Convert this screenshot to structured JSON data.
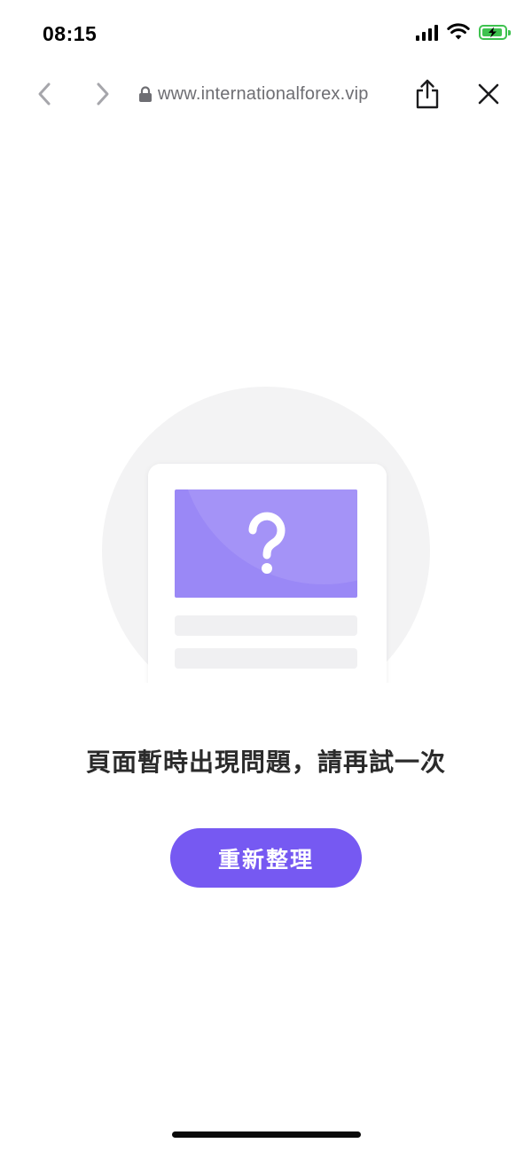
{
  "status_bar": {
    "time": "08:15",
    "icons": [
      "signal-icon",
      "wifi-icon",
      "battery-charging-icon"
    ],
    "battery_color": "#3ec24f"
  },
  "toolbar": {
    "back_icon": "chevron-left-icon",
    "forward_icon": "chevron-right-icon",
    "lock_icon": "lock-icon",
    "url": "www.internationalforex.vip",
    "share_icon": "share-icon",
    "close_icon": "close-icon"
  },
  "error_page": {
    "illustration_icon": "question-mark-icon",
    "message": "頁面暫時出現問題，請再試一次",
    "reload_label": "重新整理"
  },
  "colors": {
    "accent": "#7659f2",
    "illustration_purple": "#9a88f6",
    "text": "#2b2b2b",
    "url_text": "#6e6e73"
  }
}
